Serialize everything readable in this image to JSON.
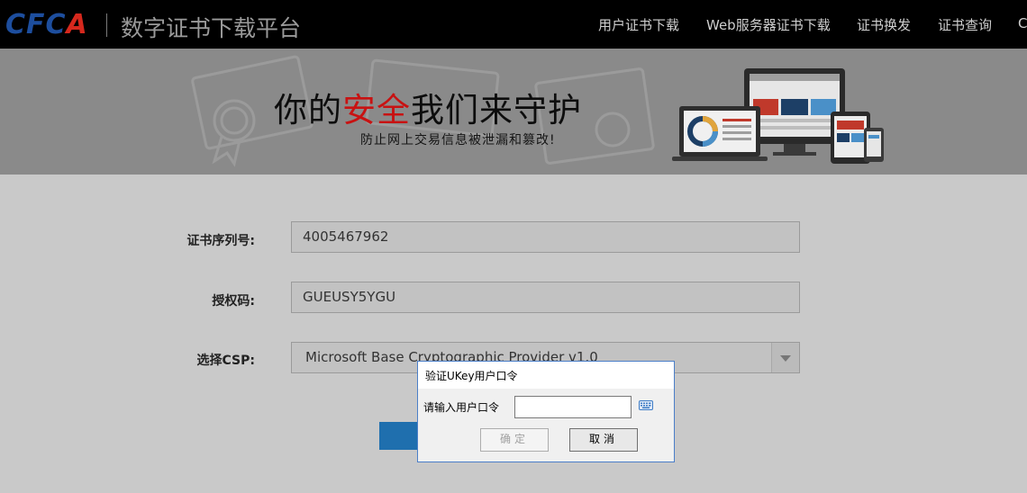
{
  "header": {
    "logo_text": "CFCA",
    "site_title": "数字证书下载平台",
    "nav": [
      {
        "label": "用户证书下载"
      },
      {
        "label": "Web服务器证书下载"
      },
      {
        "label": "证书换发"
      },
      {
        "label": "证书查询"
      },
      {
        "label": "C"
      }
    ]
  },
  "banner": {
    "slogan_part1": "你的",
    "slogan_highlight": "安全",
    "slogan_part2": "我们来守护",
    "subtitle": "防止网上交易信息被泄漏和篡改!"
  },
  "form": {
    "serial_label": "证书序列号:",
    "serial_value": "4005467962",
    "auth_label": "授权码:",
    "auth_value": "GUEUSY5YGU",
    "csp_label": "选择CSP:",
    "csp_value": "Microsoft Base Cryptographic Provider v1.0"
  },
  "dialog": {
    "title": "验证UKey用户口令",
    "prompt": "请输入用户口令",
    "input_value": "",
    "ok_label": "确定",
    "cancel_label": "取消"
  },
  "colors": {
    "header_bg": "#000000",
    "banner_bg": "#8a8a8a",
    "slogan_highlight": "#c81212",
    "logo_blue": "#1d4e9e",
    "logo_red": "#d5281d",
    "submit_button": "#1f6fae",
    "dialog_border": "#4b7fc9"
  }
}
